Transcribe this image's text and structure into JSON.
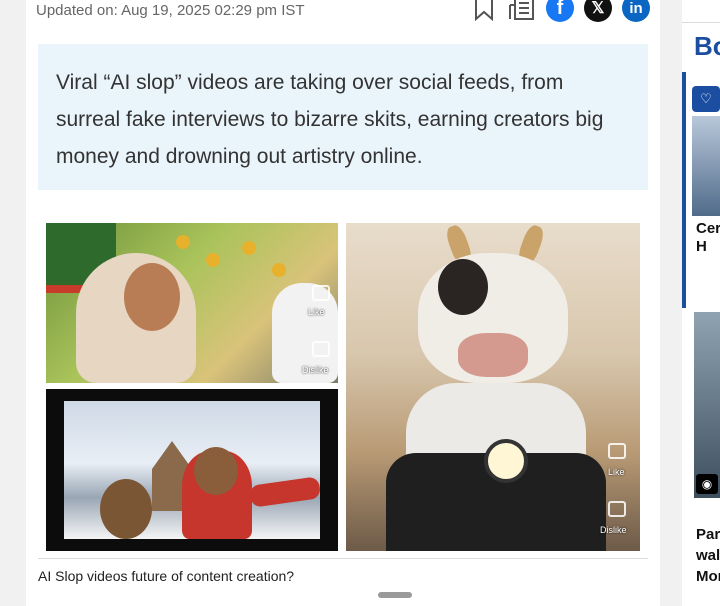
{
  "meta": {
    "updated": "Updated on: Aug 19, 2025 02:29 pm IST"
  },
  "share_icons": [
    "bookmark-icon",
    "news-icon",
    "facebook-icon",
    "x-icon",
    "linkedin-icon"
  ],
  "summary": {
    "text": "Viral “AI slop” videos are taking over social feeds, from surreal fake interviews to bizarre skits, earning creators big money and drowning out artistry online."
  },
  "figure": {
    "panel1": {
      "like_label": "Like",
      "dislike_label": "Dislike"
    },
    "panel3": {
      "like_label": "Like",
      "dislike_label": "Dislike"
    }
  },
  "caption": "AI Slop videos future of content creation?",
  "sidebar": {
    "brand": "Bo",
    "card1_text": "Cer\nH",
    "card2_text": "Par\nwal\nMor"
  },
  "colors": {
    "summary_bg": "#eaf4fb",
    "brand_blue": "#1b4ea0",
    "facebook": "#1877f2",
    "linkedin": "#0a66c2"
  }
}
